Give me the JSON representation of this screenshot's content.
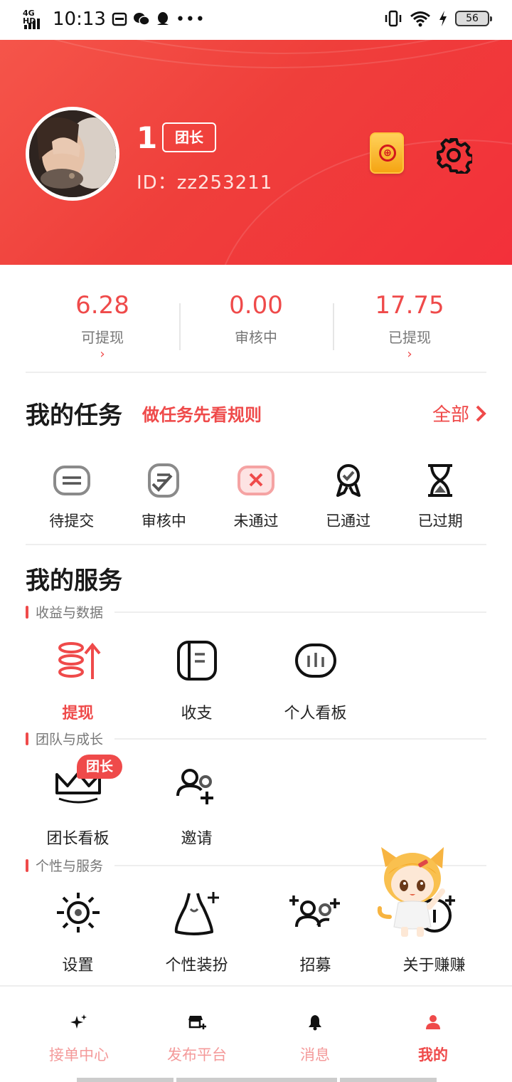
{
  "status_bar": {
    "time": "10:13",
    "network": "4G HD",
    "battery": "56"
  },
  "profile": {
    "name": "1",
    "role_tag": "团长",
    "id_text": "ID：zz253211"
  },
  "stats": [
    {
      "value": "6.28",
      "label": "可提现",
      "chevron": "›"
    },
    {
      "value": "0.00",
      "label": "审核中",
      "chevron": ""
    },
    {
      "value": "17.75",
      "label": "已提现",
      "chevron": "›"
    }
  ],
  "tasks": {
    "title": "我的任务",
    "rule_link": "做任务先看规则",
    "all_label": "全部",
    "items": [
      {
        "label": "待提交",
        "icon": "pending-icon"
      },
      {
        "label": "审核中",
        "icon": "reviewing-icon"
      },
      {
        "label": "未通过",
        "icon": "rejected-icon"
      },
      {
        "label": "已通过",
        "icon": "approved-icon"
      },
      {
        "label": "已过期",
        "icon": "expired-icon"
      }
    ]
  },
  "services": {
    "title": "我的服务",
    "sections": [
      {
        "label": "收益与数据",
        "items": [
          {
            "label": "提现",
            "icon": "withdraw-icon"
          },
          {
            "label": "收支",
            "icon": "ledger-icon"
          },
          {
            "label": "个人看板",
            "icon": "dashboard-icon"
          }
        ]
      },
      {
        "label": "团队与成长",
        "items": [
          {
            "label": "团长看板",
            "icon": "crown-icon",
            "badge": "团长"
          },
          {
            "label": "邀请",
            "icon": "invite-icon"
          }
        ]
      },
      {
        "label": "个性与服务",
        "items": [
          {
            "label": "设置",
            "icon": "settings-sun-icon"
          },
          {
            "label": "个性装扮",
            "icon": "dress-icon"
          },
          {
            "label": "招募",
            "icon": "recruit-icon"
          },
          {
            "label": "关于赚赚",
            "icon": "about-icon"
          }
        ]
      }
    ]
  },
  "bottom_nav": [
    {
      "label": "接单中心",
      "icon": "sparkle-icon"
    },
    {
      "label": "发布平台",
      "icon": "store-icon"
    },
    {
      "label": "消息",
      "icon": "bell-icon"
    },
    {
      "label": "我的",
      "icon": "person-icon",
      "active": true
    }
  ],
  "colors": {
    "brand_red": "#ef4a4a",
    "header_red": "#f3303a",
    "coin_gold": "#f5a413"
  }
}
